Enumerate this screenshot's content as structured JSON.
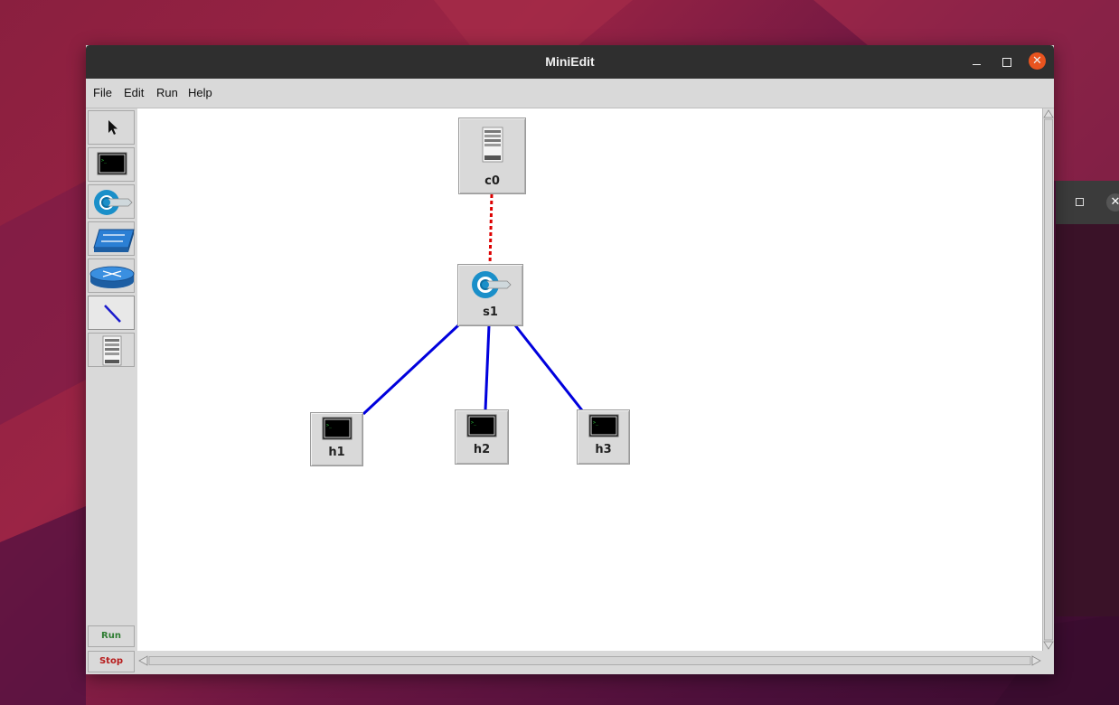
{
  "window": {
    "title": "MiniEdit"
  },
  "menubar": {
    "items": [
      "File",
      "Edit",
      "Run",
      "Help"
    ]
  },
  "toolbar": {
    "tools": [
      {
        "icon": "select-arrow-icon"
      },
      {
        "icon": "host-icon"
      },
      {
        "icon": "switch-icon"
      },
      {
        "icon": "legacy-switch-icon"
      },
      {
        "icon": "router-icon"
      },
      {
        "icon": "link-icon"
      },
      {
        "icon": "controller-icon"
      }
    ],
    "run_label": "Run",
    "stop_label": "Stop",
    "run_color": "#2e7d32",
    "stop_color": "#b71c1c"
  },
  "topology": {
    "nodes": [
      {
        "id": "c0",
        "label": "c0",
        "type": "controller"
      },
      {
        "id": "s1",
        "label": "s1",
        "type": "switch"
      },
      {
        "id": "h1",
        "label": "h1",
        "type": "host"
      },
      {
        "id": "h2",
        "label": "h2",
        "type": "host"
      },
      {
        "id": "h3",
        "label": "h3",
        "type": "host"
      }
    ],
    "links": [
      {
        "from": "c0",
        "to": "s1",
        "kind": "control",
        "color": "#dd0000",
        "style": "dashed"
      },
      {
        "from": "s1",
        "to": "h1",
        "kind": "data",
        "color": "#0000dd"
      },
      {
        "from": "s1",
        "to": "h2",
        "kind": "data",
        "color": "#0000dd"
      },
      {
        "from": "s1",
        "to": "h3",
        "kind": "data",
        "color": "#0000dd"
      }
    ]
  },
  "colors": {
    "close_button": "#e9541f",
    "titlebar": "#2f2f2f"
  }
}
